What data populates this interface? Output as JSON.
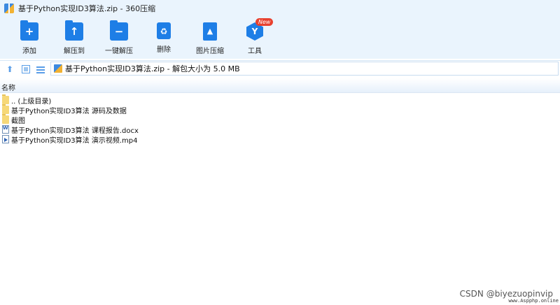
{
  "window": {
    "title": "基于Python实现ID3算法.zip - 360压缩"
  },
  "toolbar": {
    "items": [
      {
        "label": "添加",
        "icon": "add-folder-icon"
      },
      {
        "label": "解压到",
        "icon": "extract-to-icon"
      },
      {
        "label": "一键解压",
        "icon": "one-click-extract-icon"
      },
      {
        "label": "删除",
        "icon": "recycle-bin-icon"
      },
      {
        "label": "图片压缩",
        "icon": "image-compress-icon"
      },
      {
        "label": "工具",
        "icon": "tools-icon"
      }
    ],
    "new_badge": "New"
  },
  "address": {
    "path": "基于Python实现ID3算法.zip - 解包大小为 5.0 MB"
  },
  "list": {
    "column_name": "名称",
    "items": [
      {
        "name": ".. (上级目录)",
        "type": "parent-folder"
      },
      {
        "name": "基于Python实现ID3算法 源码及数据",
        "type": "folder"
      },
      {
        "name": "截图",
        "type": "folder"
      },
      {
        "name": "基于Python实现ID3算法 课程报告.docx",
        "type": "docx"
      },
      {
        "name": "基于Python实现ID3算法 演示视频.mp4",
        "type": "mp4"
      }
    ]
  },
  "watermark": "CSDN @biyezuopinvip",
  "corner_mark": "www.Aspphp.online",
  "colors": {
    "accent": "#1e7ee6",
    "toolbar_bg": "#eaf4fd",
    "badge": "#e8412f"
  }
}
